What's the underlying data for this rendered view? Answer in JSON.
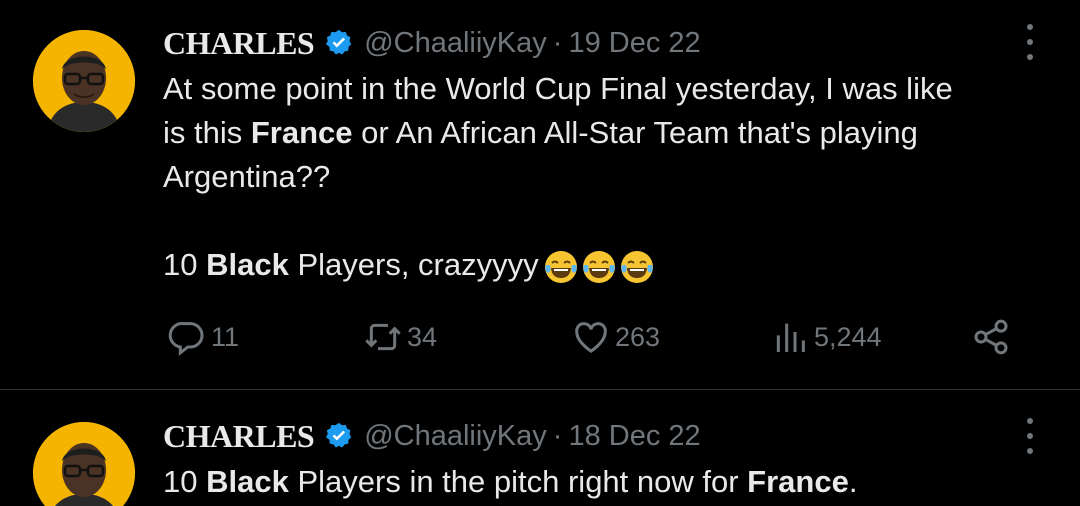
{
  "tweets": [
    {
      "author_name": "CHARLES",
      "handle": "@ChaaliiyKay",
      "separator": "·",
      "date": "19 Dec 22",
      "text": {
        "line1": "At some point in the World Cup Final yesterday, I was like",
        "line2_pre": "is this ",
        "line2_bold": "France",
        "line2_post": " or An African All-Star Team that's playing",
        "line3": "Argentina??",
        "line4_pre": "10 ",
        "line4_bold": "Black",
        "line4_post": " Players, crazyyyy"
      },
      "emojis": [
        "face-with-tears-of-joy",
        "face-with-tears-of-joy",
        "face-with-tears-of-joy"
      ],
      "actions": {
        "replies": "11",
        "retweets": "34",
        "likes": "263",
        "views": "5,244"
      }
    },
    {
      "author_name": "CHARLES",
      "handle": "@ChaaliiyKay",
      "separator": "·",
      "date": "18 Dec 22",
      "text": {
        "line1_pre": "10 ",
        "line1_bold": "Black",
        "line1_mid": " Players in the pitch right now for ",
        "line1_bold2": "France",
        "line1_post": "."
      }
    }
  ],
  "colors": {
    "background": "#000000",
    "text": "#e7e9ea",
    "muted": "#71767b",
    "verified": "#1d9bf0",
    "avatar_bg": "#f4b400",
    "divider": "#2f3336"
  },
  "icons": [
    "verified-badge-icon",
    "more-icon",
    "reply-icon",
    "retweet-icon",
    "like-icon",
    "views-icon",
    "share-icon"
  ]
}
